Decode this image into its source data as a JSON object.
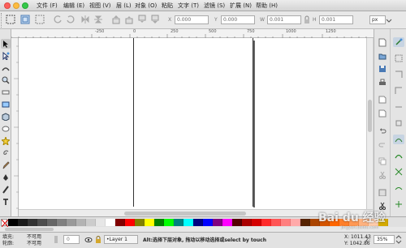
{
  "menu": {
    "items": [
      "文件 (F)",
      "编辑 (E)",
      "视图 (V)",
      "层 (L)",
      "对象 (O)",
      "粘贴",
      "文字 (T)",
      "滤镜 (S)",
      "扩展 (N)",
      "帮助 (H)"
    ]
  },
  "commandbar": {
    "x_label": "X",
    "x_value": "0.000",
    "y_label": "Y",
    "y_value": "0.000",
    "w_label": "W",
    "w_value": "0.001",
    "h_label": "H",
    "h_value": "0.001",
    "unit": "px"
  },
  "ruler": {
    "ticks": [
      "-250",
      "0",
      "250",
      "500",
      "750",
      "1000",
      "1250"
    ]
  },
  "status": {
    "fill_label": "填充:",
    "fill_value": "不可用",
    "stroke_label": "轮廓:",
    "stroke_value": "不可用",
    "opacity_value": "0",
    "layer_value": "•Layer 1",
    "message": "Alt:选择下层对象, 拖动以移动选择或select by touch",
    "x_coord": "X: 1011.43",
    "y_coord": "Y: 1042.86",
    "zoom_label": "Z:",
    "zoom_value": "35%"
  },
  "watermark": {
    "text": "Bai du 经验",
    "subtext": "jingyan.baidu.com"
  },
  "colors": {
    "palette": [
      "#000000",
      "#1a1a1a",
      "#333333",
      "#4d4d4d",
      "#666666",
      "#808080",
      "#999999",
      "#b3b3b3",
      "#cccccc",
      "#e6e6e6",
      "#ffffff",
      "#800000",
      "#ff0000",
      "#808000",
      "#ffff00",
      "#008000",
      "#00ff00",
      "#008080",
      "#00ffff",
      "#000080",
      "#0000ff",
      "#800080",
      "#ff00ff",
      "#550000",
      "#aa0000",
      "#d40000",
      "#ff2a2a",
      "#ff5555",
      "#ff8080",
      "#ffaaaa",
      "#552200",
      "#aa4400",
      "#d45500",
      "#ff6600",
      "#ff7f2a",
      "#ff9955",
      "#ffb380",
      "#ffccaa",
      "#d4aa00"
    ]
  }
}
